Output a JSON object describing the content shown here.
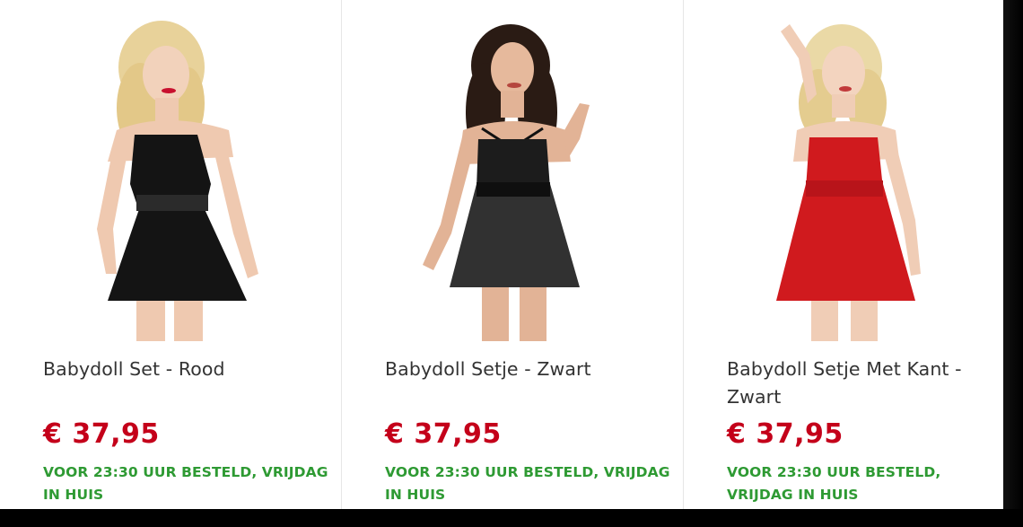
{
  "products": [
    {
      "title": "Babydoll Set - Rood",
      "price": "€ 37,95",
      "delivery": "VOOR 23:30 UUR BESTELD, VRIJDAG IN HUIS",
      "image": "model-black-babydoll-photo",
      "dress_color": "#141414",
      "hair_color": "#e8d29a"
    },
    {
      "title": "Babydoll Setje - Zwart",
      "price": "€ 37,95",
      "delivery": "VOOR 23:30 UUR BESTELD, VRIJDAG IN HUIS",
      "image": "model-black-lace-babydoll-photo",
      "dress_color": "#1c1c1c",
      "hair_color": "#2a1b14"
    },
    {
      "title": "Babydoll Setje Met Kant - Zwart",
      "price": "€ 37,95",
      "delivery": "VOOR 23:30 UUR BESTELD, VRIJDAG IN HUIS",
      "image": "model-red-babydoll-photo",
      "dress_color": "#d01a1e",
      "hair_color": "#ead9a6"
    }
  ],
  "colors": {
    "price": "#c4001a",
    "delivery": "#2e9a33",
    "title": "#333333"
  }
}
